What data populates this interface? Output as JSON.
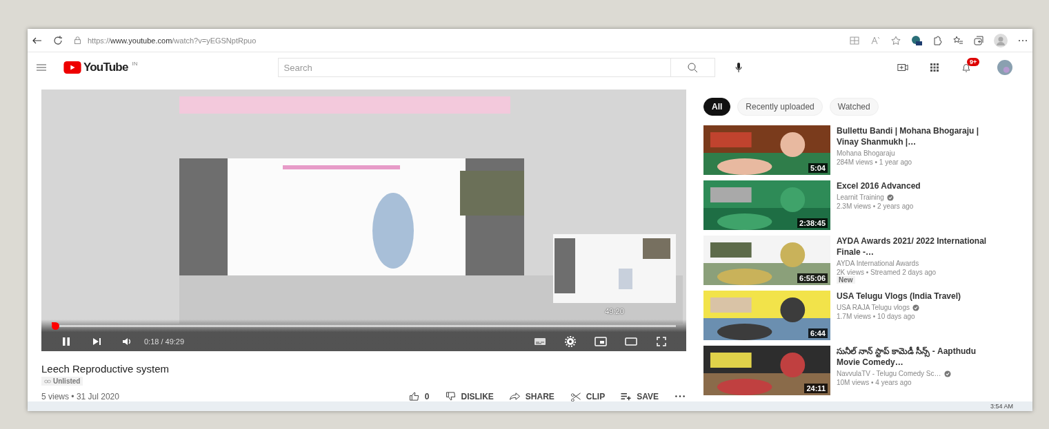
{
  "browser": {
    "url_scheme": "https://",
    "url_host": "www.youtube.com",
    "url_path": "/watch?v=yEGSNptRpuo"
  },
  "header": {
    "logo": "YouTube",
    "region": "IN",
    "search_placeholder": "Search",
    "notifications": "9+"
  },
  "player": {
    "playing": true,
    "level": 0.006,
    "time": "0:18 / 49:29",
    "preview_time": "49:20"
  },
  "video": {
    "title": "Leech Reproductive system",
    "visibility": "Unlisted",
    "meta": "5 views • 31 Jul 2020"
  },
  "actions": [
    {
      "kind": "like",
      "label": "0"
    },
    {
      "kind": "dislike",
      "label": "DISLIKE"
    },
    {
      "kind": "share",
      "label": "SHARE"
    },
    {
      "kind": "clip",
      "label": "CLIP"
    },
    {
      "kind": "save",
      "label": "SAVE"
    },
    {
      "kind": "more"
    }
  ],
  "chips": [
    {
      "label": "All",
      "selected": true
    },
    {
      "label": "Recently uploaded",
      "selected": false
    },
    {
      "label": "Watched",
      "selected": false
    }
  ],
  "recommendations": [
    {
      "title": "Bullettu Bandi | Mohana Bhogaraju | Vinay Shanmukh |…",
      "channel": "Mohana Bhogaraju",
      "verified": false,
      "stats": "284M views • 1 year ago",
      "duration": "5:04"
    },
    {
      "title": "Excel 2016 Advanced",
      "channel": "Learnit Training",
      "verified": true,
      "stats": "2.3M views • 2 years ago",
      "duration": "2:38:45"
    },
    {
      "title": "AYDA Awards 2021/ 2022 International Finale -…",
      "channel": "AYDA International Awards",
      "verified": false,
      "stats": "2K views • Streamed 2 days ago",
      "badge": "New",
      "duration": "6:55:06"
    },
    {
      "title": "USA Telugu Vlogs (India Travel)",
      "channel": "USA RAJA Telugu vlogs",
      "verified": true,
      "stats": "1.7M views • 10 days ago",
      "duration": "6:44"
    },
    {
      "title": "సునీల్ నాన్ స్టాప్ కామెడీ సీన్స్ - Aapthudu Movie Comedy…",
      "channel": "NavvulaTV - Telugu Comedy Sc…",
      "verified": true,
      "stats": "10M views • 4 years ago",
      "duration": "24:11"
    }
  ],
  "taskbar": {
    "clock": "3:54 AM"
  }
}
